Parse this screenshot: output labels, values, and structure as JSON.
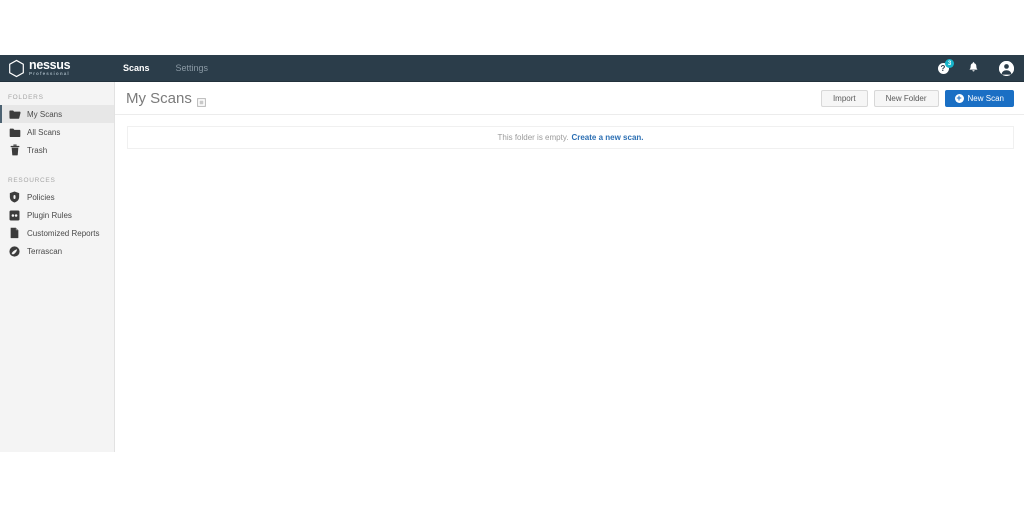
{
  "brand": {
    "name": "nessus",
    "subtitle": "Professional",
    "logo_icon": "hexagon-icon"
  },
  "nav": {
    "items": [
      {
        "label": "Scans",
        "active": true
      },
      {
        "label": "Settings",
        "active": false
      }
    ]
  },
  "header_right": {
    "help": {
      "icon": "help-circle-icon",
      "glyph": "?",
      "badge": "3",
      "badge_color": "#17b3c9"
    },
    "notifications": {
      "icon": "bell-icon"
    },
    "account": {
      "icon": "user-avatar-icon"
    }
  },
  "sidebar": {
    "sections": [
      {
        "title": "FOLDERS",
        "items": [
          {
            "label": "My Scans",
            "icon": "folder-open-icon",
            "active": true
          },
          {
            "label": "All Scans",
            "icon": "folder-icon",
            "active": false
          },
          {
            "label": "Trash",
            "icon": "trash-icon",
            "active": false
          }
        ]
      },
      {
        "title": "RESOURCES",
        "items": [
          {
            "label": "Policies",
            "icon": "shield-icon",
            "active": false
          },
          {
            "label": "Plugin Rules",
            "icon": "plugin-rules-icon",
            "active": false
          },
          {
            "label": "Customized Reports",
            "icon": "document-icon",
            "active": false
          },
          {
            "label": "Terrascan",
            "icon": "terrascan-icon",
            "active": false
          }
        ]
      }
    ]
  },
  "page": {
    "title": "My Scans",
    "title_icon": "edit-square-icon"
  },
  "toolbar": {
    "import_label": "Import",
    "new_folder_label": "New Folder",
    "new_scan_label": "New Scan",
    "new_scan_icon": "plus-circle-icon",
    "primary_color": "#1a6fc4"
  },
  "empty_state": {
    "message": "This folder is empty.",
    "link_label": "Create a new scan.",
    "link_color": "#2c6fb3"
  },
  "colors": {
    "header_bg": "#2b3d4a",
    "sidebar_bg": "#f4f4f4",
    "accent_teal": "#17b3c9"
  }
}
